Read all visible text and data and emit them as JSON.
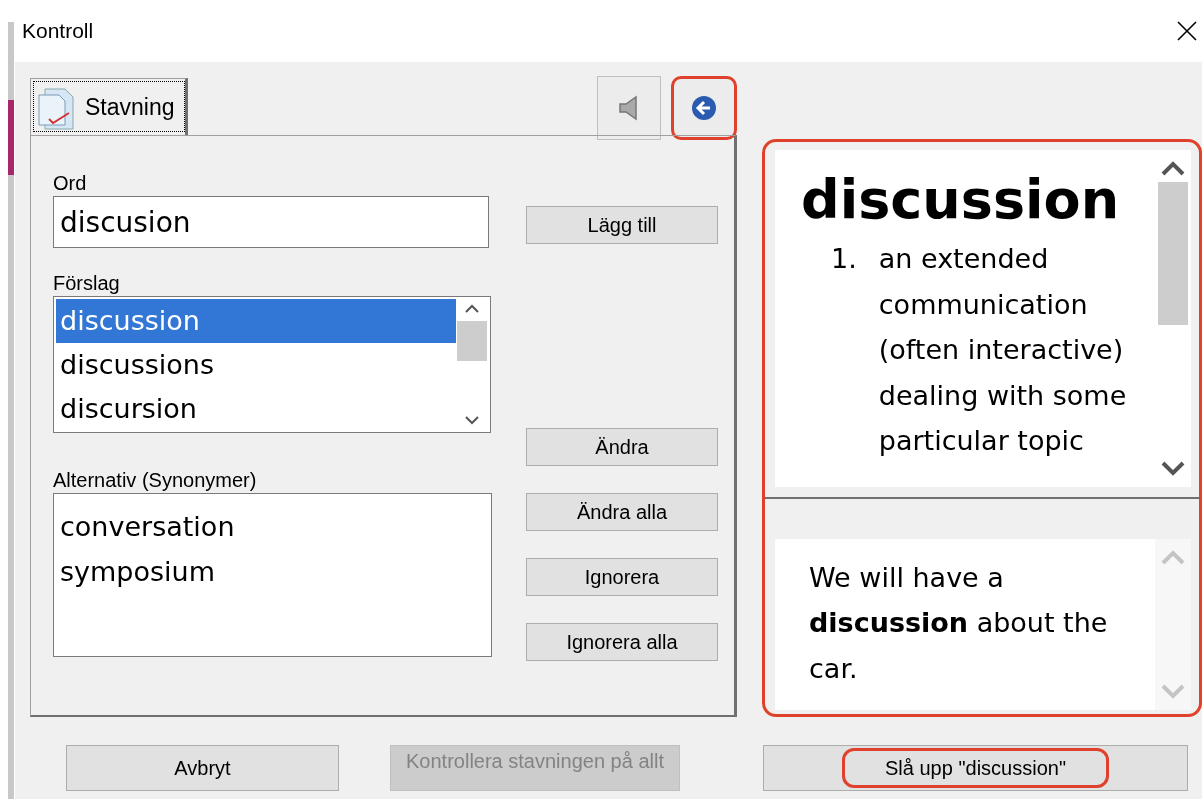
{
  "window": {
    "title": "Kontroll"
  },
  "tabs": [
    {
      "label": "Stavning",
      "selected": true
    }
  ],
  "toolbar": [
    {
      "kind": "speaker",
      "highlighted": false
    },
    {
      "kind": "back",
      "highlighted": true
    }
  ],
  "word": {
    "label": "Ord",
    "value": "discusion",
    "action": "Lägg till"
  },
  "suggestions": {
    "label": "Förslag",
    "items": [
      {
        "text": "discussion",
        "selected": true
      },
      {
        "text": "discussions",
        "selected": false
      },
      {
        "text": "discursion",
        "selected": false
      }
    ]
  },
  "synonyms": {
    "label": "Alternativ (Synonymer)",
    "items": [
      "conversation",
      "symposium"
    ]
  },
  "actions": [
    {
      "label": "Ändra"
    },
    {
      "label": "Ändra alla"
    },
    {
      "label": "Ignorera"
    },
    {
      "label": "Ignorera alla"
    }
  ],
  "definition": {
    "highlighted": true,
    "headword": "discussion",
    "senses": [
      {
        "number": "1.",
        "text": "an extended communication (often interactive) dealing with some particular topic"
      }
    ],
    "example": "We will have a **discussion** about the car."
  },
  "buttons": [
    {
      "label": "Avbryt",
      "disabled": false,
      "highlighted": false
    },
    {
      "label": "Kontrollera stavningen på allt",
      "disabled": true,
      "highlighted": false
    },
    {
      "label": "Slå upp \"discussion\"",
      "disabled": false,
      "highlighted": true
    }
  ]
}
